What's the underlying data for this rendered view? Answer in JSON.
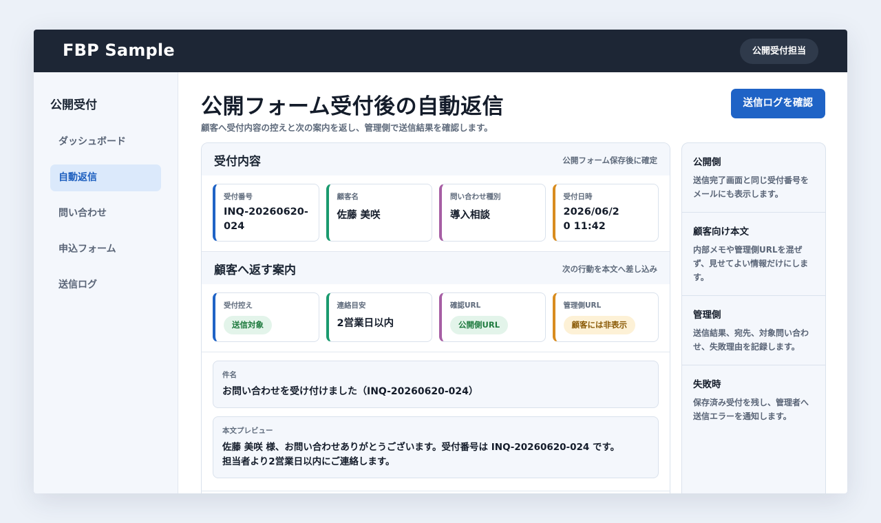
{
  "header": {
    "brand": "FBP Sample",
    "user": "公開受付担当"
  },
  "sidebar": {
    "title": "公開受付",
    "items": [
      {
        "label": "ダッシュボード"
      },
      {
        "label": "自動返信"
      },
      {
        "label": "問い合わせ"
      },
      {
        "label": "申込フォーム"
      },
      {
        "label": "送信ログ"
      }
    ],
    "active_index": 1
  },
  "page": {
    "title": "公開フォーム受付後の自動返信",
    "subtitle": "顧客へ受付内容の控えと次の案内を返し、管理側で送信結果を確認します。",
    "primary_button": "送信ログを確認"
  },
  "reception": {
    "title": "受付内容",
    "note": "公開フォーム保存後に確定",
    "tiles": [
      {
        "label": "受付番号",
        "value": "INQ-20260620-024",
        "accent": "blue"
      },
      {
        "label": "顧客名",
        "value": "佐藤 美咲",
        "accent": "green"
      },
      {
        "label": "問い合わせ種別",
        "value": "導入相談",
        "accent": "purple"
      },
      {
        "label": "受付日時",
        "value": "2026/06/20 11:42",
        "accent": "orange"
      }
    ]
  },
  "guidance": {
    "title": "顧客へ返す案内",
    "note": "次の行動を本文へ差し込み",
    "tiles": [
      {
        "label": "受付控え",
        "badge": "送信対象",
        "badge_color": "green",
        "accent": "blue"
      },
      {
        "label": "連絡目安",
        "value": "2営業日以内",
        "accent": "green"
      },
      {
        "label": "確認URL",
        "badge": "公開側URL",
        "badge_color": "green",
        "accent": "purple"
      },
      {
        "label": "管理側URL",
        "badge": "顧客には非表示",
        "badge_color": "amber",
        "accent": "orange"
      }
    ]
  },
  "email": {
    "subject_label": "件名",
    "subject": "お問い合わせを受け付けました（INQ-20260620-024）",
    "body_label": "本文プレビュー",
    "body_line1": "佐藤 美咲 様、お問い合わせありがとうございます。受付番号は INQ-20260620-024 です。",
    "body_line2": "担当者より2営業日以内にご連絡します。"
  },
  "notes": [
    {
      "title": "公開側",
      "text": "送信完了画面と同じ受付番号をメールにも表示します。"
    },
    {
      "title": "顧客向け本文",
      "text": "内部メモや管理側URLを混ぜず、見せてよい情報だけにします。"
    },
    {
      "title": "管理側",
      "text": "送信結果、宛先、対象問い合わせ、失敗理由を記録します。"
    },
    {
      "title": "失敗時",
      "text": "保存済み受付を残し、管理者へ送信エラーを通知します。"
    }
  ],
  "colors": {
    "topbar": "#1d2635",
    "primary": "#1f63c6",
    "accent_blue": "#1f63c6",
    "accent_green": "#1a9a6e",
    "accent_purple": "#a65ea4",
    "accent_orange": "#d98c1e"
  }
}
